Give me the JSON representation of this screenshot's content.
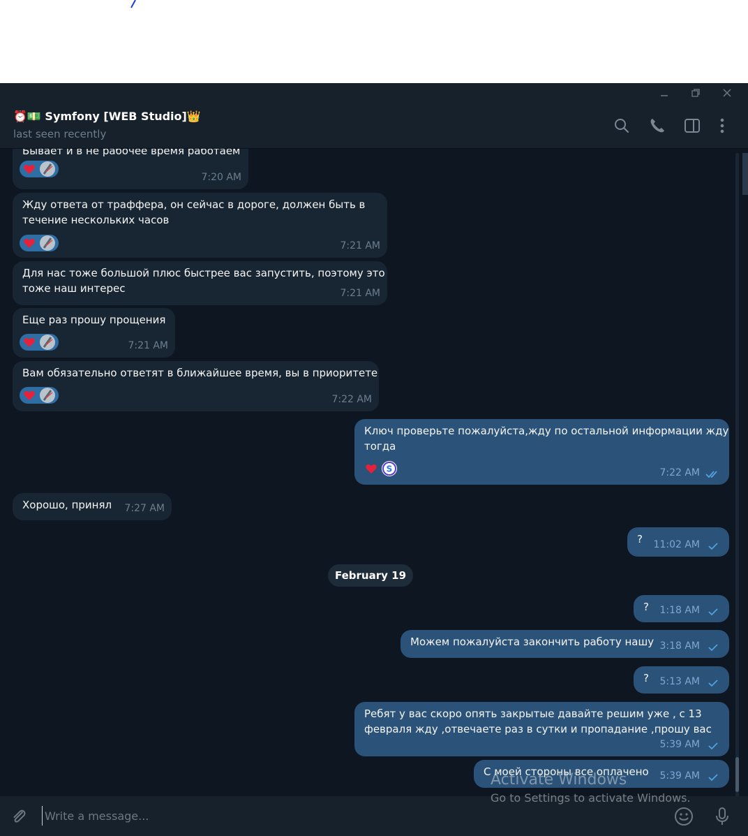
{
  "chat": {
    "title": "⏰💵 Symfony [WEB Studio]👑",
    "status": "last seen recently"
  },
  "messages": [
    {
      "id": "m1",
      "side": "in",
      "text": "Бывает и в не рабочее время работаем",
      "time": "7:20 AM",
      "reactions": [
        "heart",
        "avatar"
      ]
    },
    {
      "id": "m2",
      "side": "in",
      "text_lines": [
        "Жду ответа от траффера, он сейчас в дороге, должен быть в",
        "течение нескольких часов"
      ],
      "time": "7:21 AM",
      "reactions": [
        "heart",
        "avatar"
      ]
    },
    {
      "id": "m3",
      "side": "in",
      "text_lines": [
        "Для нас тоже большой плюс быстрее вас запустить, поэтому это",
        "тоже наш интерес"
      ],
      "time": "7:21 AM"
    },
    {
      "id": "m4",
      "side": "in",
      "text": "Еще раз прошу прощения",
      "time": "7:21 AM",
      "reactions": [
        "heart",
        "avatar"
      ]
    },
    {
      "id": "m5",
      "side": "in",
      "text": "Вам обязательно ответят в ближайшее время, вы в приоритете",
      "time": "7:22 AM",
      "reactions": [
        "heart",
        "avatar"
      ]
    },
    {
      "id": "m6",
      "side": "out",
      "text_lines": [
        "Ключ проверьте пожалуйста,жду по остальной информации жду",
        "тогда"
      ],
      "time": "7:22 AM",
      "status": "read",
      "reactions": [
        "heart",
        "avatar-s"
      ]
    },
    {
      "id": "m7",
      "side": "in",
      "text": "Хорошо, принял",
      "time": "7:27 AM"
    },
    {
      "id": "m8",
      "side": "out",
      "text": "?",
      "time": "11:02 AM",
      "status": "sent"
    },
    {
      "id": "m9",
      "side": "out",
      "text": "?",
      "time": "1:18 AM",
      "status": "sent"
    },
    {
      "id": "m10",
      "side": "out",
      "text": "Можем пожалуйста закончить работу нашу",
      "time": "3:18 AM",
      "status": "sent"
    },
    {
      "id": "m11",
      "side": "out",
      "text": "?",
      "time": "5:13 AM",
      "status": "sent"
    },
    {
      "id": "m12",
      "side": "out",
      "text_lines": [
        "Ребят у вас скоро опять закрытые давайте решим уже , с 13",
        "февраля жду ,отвечаете раз в сутки и пропадание ,прошу вас"
      ],
      "time": "5:39 AM",
      "status": "sent"
    },
    {
      "id": "m13",
      "side": "out",
      "text": "С моей стороны все оплачено",
      "time": "5:39 AM",
      "status": "sent"
    }
  ],
  "date_separator": "February 19",
  "composer": {
    "placeholder": "Write a message..."
  },
  "watermark": {
    "title": "Activate Windows",
    "subtitle": "Go to Settings to activate Windows."
  },
  "colors": {
    "background": "#0e1621",
    "header": "#17212b",
    "incoming_bubble": "#182533",
    "outgoing_bubble": "#2b5278",
    "check": "#4fa3e0"
  },
  "icons": [
    "attach-icon",
    "search-icon",
    "phone-icon",
    "sidebar-toggle-icon",
    "more-icon",
    "emoji-icon",
    "microphone-icon",
    "heart-icon",
    "check-icon",
    "double-check-icon"
  ]
}
